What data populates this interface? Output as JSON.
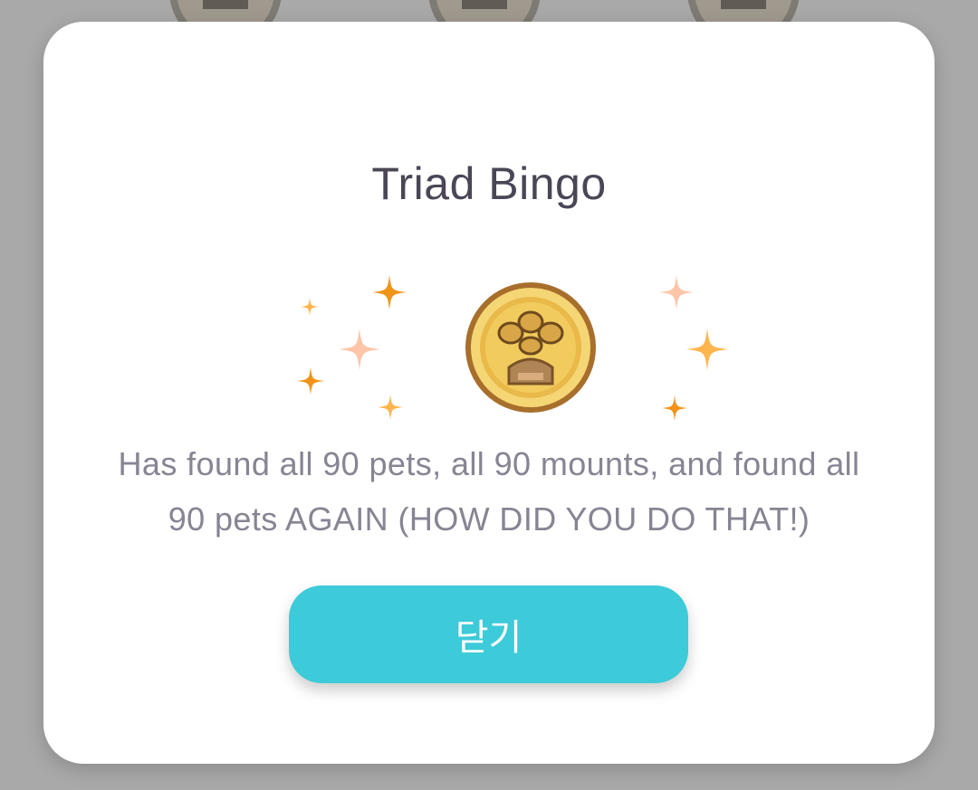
{
  "dialog": {
    "title": "Triad Bingo",
    "description": "Has found all 90 pets, all 90 mounts, and found all 90 pets AGAIN (HOW DID YOU DO THAT!)",
    "close_label": "닫기",
    "icon": "paw-coin-badge-icon"
  },
  "colors": {
    "button": "#3dcad9",
    "title": "#4a4656",
    "text": "#878493",
    "overlay": "#a9a9a9",
    "sparkle_orange": "#f09419",
    "sparkle_yellow": "#ffb54d",
    "sparkle_peach": "#ffc5a8",
    "coin_gold": "#f2cb5e"
  }
}
